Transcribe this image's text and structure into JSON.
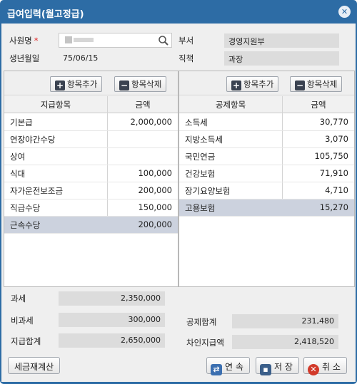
{
  "title": "급여입력(월고정급)",
  "header": {
    "emp_label": "사원명",
    "emp_required": "*",
    "emp_value": "",
    "dept_label": "부서",
    "dept_value": "경영지원부",
    "birth_label": "생년월일",
    "birth_value": "75/06/15",
    "position_label": "직책",
    "position_value": "과장"
  },
  "left": {
    "add_label": "항목추가",
    "del_label": "항목삭제",
    "col_item": "지급항목",
    "col_amount": "금액",
    "rows": [
      {
        "item": "기본급",
        "amount": "2,000,000"
      },
      {
        "item": "연장야간수당",
        "amount": ""
      },
      {
        "item": "상여",
        "amount": ""
      },
      {
        "item": "식대",
        "amount": "100,000"
      },
      {
        "item": "자가운전보조금",
        "amount": "200,000"
      },
      {
        "item": "직급수당",
        "amount": "150,000"
      },
      {
        "item": "근속수당",
        "amount": "200,000"
      }
    ]
  },
  "right": {
    "add_label": "항목추가",
    "del_label": "항목삭제",
    "col_item": "공제항목",
    "col_amount": "금액",
    "rows": [
      {
        "item": "소득세",
        "amount": "30,770"
      },
      {
        "item": "지방소득세",
        "amount": "3,070"
      },
      {
        "item": "국민연금",
        "amount": "105,750"
      },
      {
        "item": "건강보험",
        "amount": "71,910"
      },
      {
        "item": "장기요양보험",
        "amount": "4,710"
      },
      {
        "item": "고용보험",
        "amount": "15,270"
      }
    ]
  },
  "summary": {
    "taxable_label": "과세",
    "taxable_value": "2,350,000",
    "nontax_label": "비과세",
    "nontax_value": "300,000",
    "paytotal_label": "지급합계",
    "paytotal_value": "2,650,000",
    "deduct_label": "공제합계",
    "deduct_value": "231,480",
    "net_label": "차인지급액",
    "net_value": "2,418,520"
  },
  "buttons": {
    "recalc": "세금재계산",
    "continue": "연 속",
    "save": "저 장",
    "cancel": "취 소"
  },
  "icons": {
    "close": "close-icon",
    "search": "search-icon",
    "plus": "plus-icon",
    "minus": "minus-icon"
  }
}
